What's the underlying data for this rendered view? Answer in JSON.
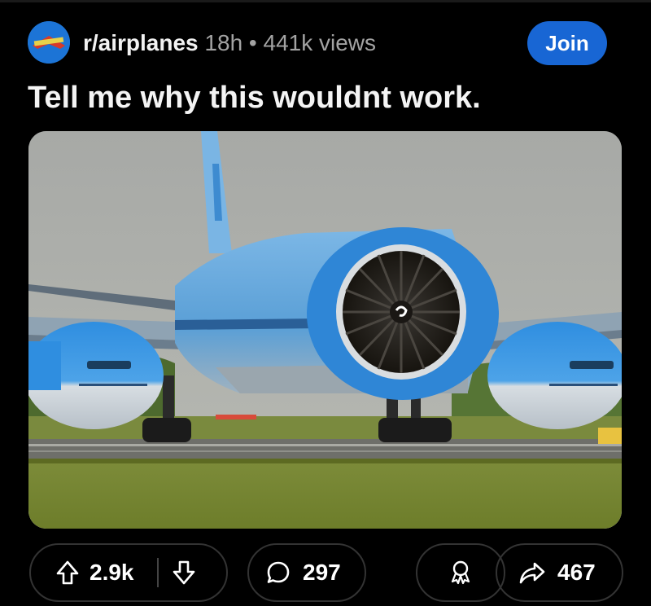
{
  "post": {
    "subreddit": "r/airplanes",
    "age": "18h",
    "separator": "•",
    "views": "441k views",
    "join_label": "Join",
    "title": "Tell me why this wouldnt work."
  },
  "actions": {
    "upvotes": "2.9k",
    "comments": "297",
    "shares": "467"
  },
  "icons": {
    "upvote": "arrow-up-icon",
    "downvote": "arrow-down-icon",
    "comment": "speech-bubble-icon",
    "award": "award-icon",
    "share": "share-arrow-icon"
  },
  "colors": {
    "background": "#000000",
    "join_button": "#1866d4",
    "muted_text": "#a3a3a3",
    "pill_border": "#333333"
  }
}
